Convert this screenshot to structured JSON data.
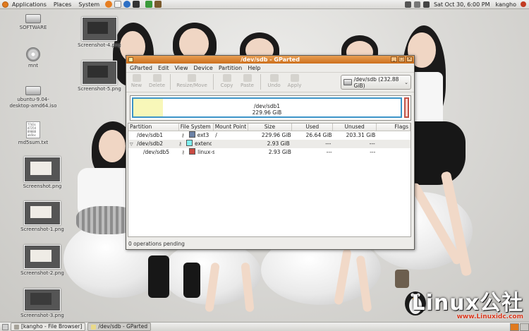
{
  "top_panel": {
    "menus": [
      "Applications",
      "Places",
      "System"
    ],
    "datetime": "Sat Oct 30,  6:00 PM",
    "user": "kangho"
  },
  "desktop_icons": [
    {
      "label": "SOFTWARE",
      "kind": "drive"
    },
    {
      "label": "mnt",
      "kind": "disc"
    },
    {
      "label": "ubuntu-9.04-desktop-amd64.iso",
      "kind": "drive"
    },
    {
      "label": "md5sum.txt",
      "kind": "text",
      "preview": "77d3c\nd7254\n89088\nab5bc"
    },
    {
      "label": "Screenshot.png",
      "kind": "thumb"
    },
    {
      "label": "Screenshot-1.png",
      "kind": "thumb"
    },
    {
      "label": "Screenshot-2.png",
      "kind": "thumb"
    },
    {
      "label": "Screenshot-3.png",
      "kind": "thumb"
    },
    {
      "label": "Screenshot-4.png",
      "kind": "thumb"
    },
    {
      "label": "Screenshot-5.png",
      "kind": "thumb"
    }
  ],
  "window": {
    "title": "/dev/sdb - GParted",
    "menu": [
      "GParted",
      "Edit",
      "View",
      "Device",
      "Partition",
      "Help"
    ],
    "toolbar": [
      "New",
      "Delete",
      "Resize/Move",
      "Copy",
      "Paste",
      "Undo",
      "Apply"
    ],
    "device_selector": "/dev/sdb  (232.88 GiB)",
    "diskmap": {
      "name": "/dev/sdb1",
      "size": "229.96 GiB",
      "used_fraction": 0.11
    },
    "columns": [
      "Partition",
      "File System",
      "Mount Point",
      "Size",
      "Used",
      "Unused",
      "Flags"
    ],
    "rows": [
      {
        "partition": "/dev/sdb1",
        "fs": "ext3",
        "color": "#6c82a6",
        "mount": "/",
        "size": "229.96 GiB",
        "used": "26.64 GiB",
        "unused": "203.31 GiB",
        "flags": ""
      },
      {
        "partition": "/dev/sdb2",
        "fs": "extended",
        "color": "#7ef0f0",
        "mount": "",
        "size": "2.93 GiB",
        "used": "---",
        "unused": "---",
        "flags": ""
      },
      {
        "partition": "/dev/sdb5",
        "fs": "linux-swap",
        "color": "#c94b43",
        "mount": "",
        "size": "2.93 GiB",
        "used": "---",
        "unused": "---",
        "flags": ""
      }
    ],
    "status": "0 operations pending"
  },
  "taskbar": [
    {
      "label": "[kangho - File Browser]"
    },
    {
      "label": "/dev/sdb - GParted"
    }
  ],
  "watermark": {
    "logo": "Linux公社",
    "url": "www.Linuxidc.com"
  }
}
